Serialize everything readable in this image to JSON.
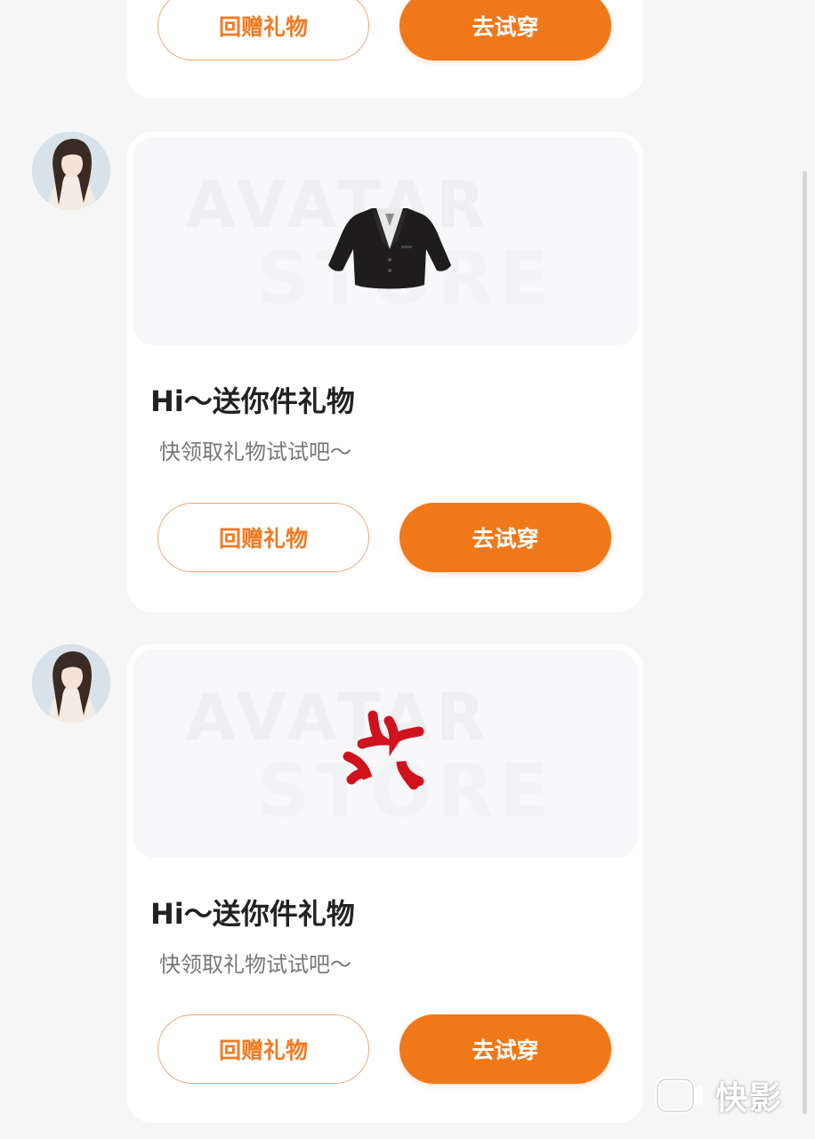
{
  "accent_color": "#f07819",
  "messages": [
    {
      "buttons": {
        "return_gift": "回赠礼物",
        "try_on": "去试穿"
      }
    },
    {
      "image_watermark": [
        "AVATAR",
        "STORE"
      ],
      "gift_icon": "black-suit-jacket-icon",
      "title": "Hi～送你件礼物",
      "subtitle": "快领取礼物试试吧～",
      "buttons": {
        "return_gift": "回赠礼物",
        "try_on": "去试穿"
      }
    },
    {
      "image_watermark": [
        "AVATAR",
        "STORE"
      ],
      "gift_icon": "anger-symbol-icon",
      "title": "Hi～送你件礼物",
      "subtitle": "快领取礼物试试吧～",
      "buttons": {
        "return_gift": "回赠礼物",
        "try_on": "去试穿"
      }
    }
  ],
  "app_watermark": {
    "label": "快影",
    "icon": "kuaiying-logo-icon"
  }
}
